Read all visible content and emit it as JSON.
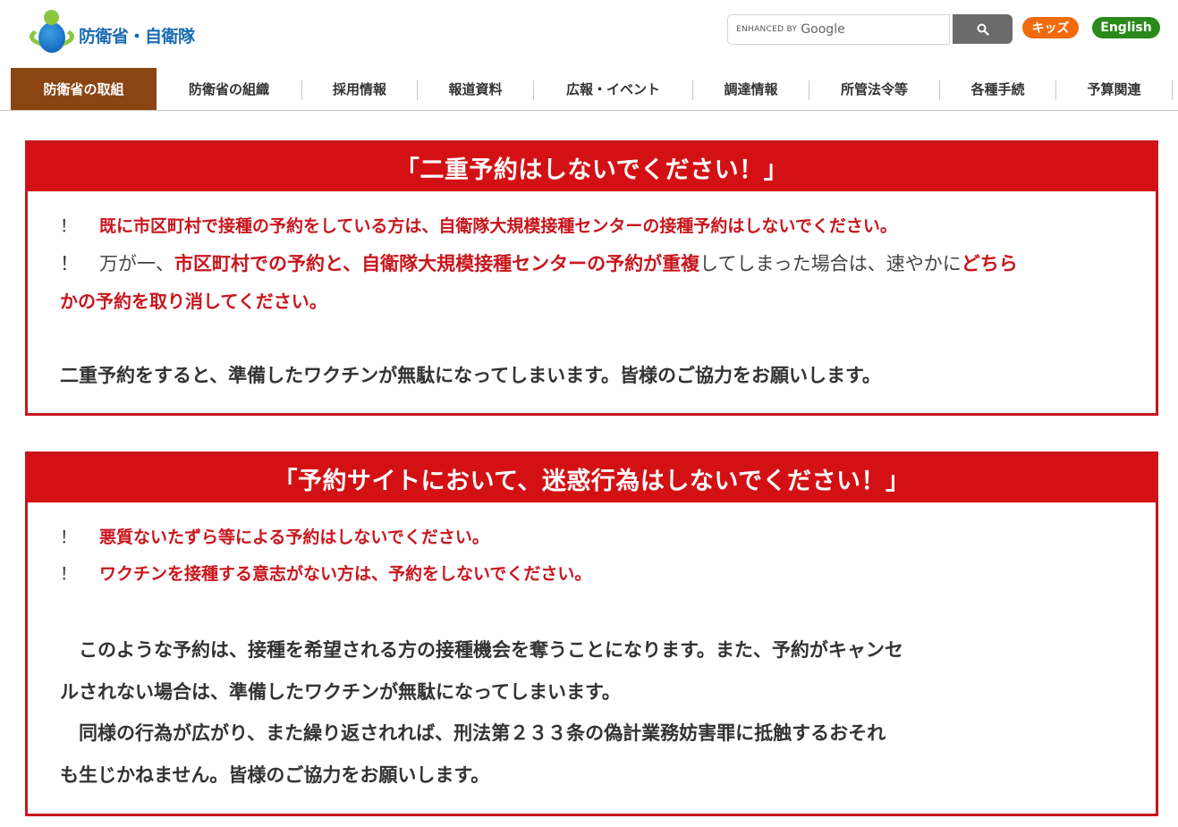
{
  "header": {
    "logo_text": "防衛省・自衛隊",
    "search": {
      "placeholder_prefix": "ENHANCED BY",
      "placeholder_brand": "Google",
      "button_icon": "search-icon"
    },
    "kids_label": "キッズ",
    "english_label": "English"
  },
  "nav": {
    "items": [
      {
        "label": "防衛省の取組",
        "active": true
      },
      {
        "label": "防衛省の組織"
      },
      {
        "label": "採用情報"
      },
      {
        "label": "報道資料"
      },
      {
        "label": "広報・イベント"
      },
      {
        "label": "調達情報"
      },
      {
        "label": "所管法令等"
      },
      {
        "label": "各種手続"
      },
      {
        "label": "予算関連"
      }
    ]
  },
  "notice1": {
    "title": "「二重予約はしないでください！」",
    "bullet_mark": "！",
    "line1": "既に市区町村で接種の予約をしている方は、自衛隊大規模接種センターの接種予約はしないでください。",
    "line2_a": "万が一、",
    "line2_b": "市区町村での予約と、自衛隊大規模接種センターの予約が重複",
    "line2_c": "してしまった場合は、速やかに",
    "line2_d": "どちら",
    "line3": "かの予約を取り消してください。",
    "closing": "二重予約をすると、準備したワクチンが無駄になってしまいます。皆様のご協力をお願いします。"
  },
  "notice2": {
    "title": "「予約サイトにおいて、迷惑行為はしないでください！」",
    "bullet_mark": "！",
    "line1": "悪質ないたずら等による予約はしないでください。",
    "line2": "ワクチンを接種する意志がない方は、予約をしないでください。",
    "para1_line1": "　このような予約は、接種を希望される方の接種機会を奪うことになります。また、予約がキャンセ",
    "para1_line2": "ルされない場合は、準備したワクチンが無駄になってしまいます。",
    "para2_line1": "　同様の行為が広がり、また繰り返されれば、刑法第２３３条の偽計業務妨害罪に抵触するおそれ",
    "para2_line2": "も生じかねません。皆様のご協力をお願いします。"
  },
  "colors": {
    "brand_red": "#d31115",
    "nav_active": "#8b4513",
    "kids_orange": "#f26a0a",
    "english_green": "#2a8a1a",
    "logo_blue": "#1a6cb3",
    "logo_green": "#8cc63f"
  }
}
